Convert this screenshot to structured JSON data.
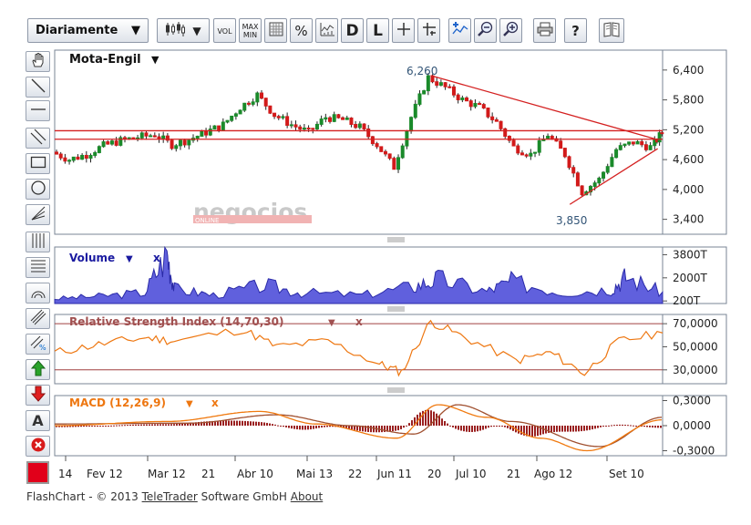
{
  "toolbar": {
    "period": "Diariamente",
    "vol_label": "VOL",
    "maxmin_label_1": "MAX",
    "maxmin_label_2": "MIN",
    "percent_label": "%",
    "d_label": "D",
    "l_label": "L",
    "help_label": "?"
  },
  "footer": {
    "prefix": "FlashChart - © 2013",
    "company_link": "TeleTrader",
    "middle": "Software GmbH",
    "about_link": "About"
  },
  "watermark": {
    "big": "negocios",
    "small": "ONLINE"
  },
  "chart_data": [
    {
      "panel": "price",
      "type": "candlestick",
      "title": "Mota-Engil",
      "y_ticks": [
        "6,400",
        "5,800",
        "5,200",
        "4,600",
        "4,000",
        "3,400"
      ],
      "ylim": [
        3100,
        6800
      ],
      "annotations": [
        {
          "text": "6,260",
          "value": 6260,
          "note": "high"
        },
        {
          "text": "3,850",
          "value": 3850,
          "note": "low"
        }
      ],
      "horizontal_lines": [
        5180,
        5010
      ],
      "trendlines": [
        {
          "from": {
            "date": "Jun 17",
            "value": 6290
          },
          "to": {
            "date": "Set 18",
            "value": 5000
          }
        },
        {
          "from": {
            "date": "Ago 13",
            "value": 3700
          },
          "to": {
            "date": "Set 18",
            "value": 4820
          }
        }
      ],
      "close_series": [
        {
          "d": "Jan 14",
          "v": 4750
        },
        {
          "d": "Jan 21",
          "v": 4600
        },
        {
          "d": "Jan 28",
          "v": 4700
        },
        {
          "d": "Fev 4",
          "v": 4880
        },
        {
          "d": "Fev 11",
          "v": 4980
        },
        {
          "d": "Fev 18",
          "v": 5050
        },
        {
          "d": "Fev 25",
          "v": 5100
        },
        {
          "d": "Mar 4",
          "v": 4900
        },
        {
          "d": "Mar 11",
          "v": 5000
        },
        {
          "d": "Mar 18",
          "v": 5150
        },
        {
          "d": "Mar 25",
          "v": 5300
        },
        {
          "d": "Abr 1",
          "v": 5650
        },
        {
          "d": "Abr 8",
          "v": 5900
        },
        {
          "d": "Abr 15",
          "v": 5500
        },
        {
          "d": "Abr 22",
          "v": 5300
        },
        {
          "d": "Abr 29",
          "v": 5150
        },
        {
          "d": "Mai 6",
          "v": 5450
        },
        {
          "d": "Mai 13",
          "v": 5400
        },
        {
          "d": "Mai 20",
          "v": 5250
        },
        {
          "d": "Mai 27",
          "v": 4900
        },
        {
          "d": "Jun 3",
          "v": 4450
        },
        {
          "d": "Jun 10",
          "v": 5450
        },
        {
          "d": "Jun 17",
          "v": 6250
        },
        {
          "d": "Jun 24",
          "v": 6050
        },
        {
          "d": "Jul 1",
          "v": 5800
        },
        {
          "d": "Jul 8",
          "v": 5650
        },
        {
          "d": "Jul 15",
          "v": 5350
        },
        {
          "d": "Jul 22",
          "v": 4850
        },
        {
          "d": "Jul 29",
          "v": 4700
        },
        {
          "d": "Ago 5",
          "v": 5100
        },
        {
          "d": "Ago 12",
          "v": 4700
        },
        {
          "d": "Ago 19",
          "v": 3950
        },
        {
          "d": "Ago 26",
          "v": 4200
        },
        {
          "d": "Set 2",
          "v": 4800
        },
        {
          "d": "Set 9",
          "v": 4950
        },
        {
          "d": "Set 16",
          "v": 4850
        },
        {
          "d": "Set 20",
          "v": 5150
        }
      ]
    },
    {
      "panel": "volume",
      "type": "area",
      "title": "Volume",
      "y_ticks": [
        "3800T",
        "2000T",
        "200T"
      ],
      "ylim": [
        0,
        4400
      ],
      "series": [
        {
          "d": "Jan 14",
          "v": 400
        },
        {
          "d": "Feb 1",
          "v": 600
        },
        {
          "d": "Feb 20",
          "v": 900
        },
        {
          "d": "Mar 1",
          "v": 4100
        },
        {
          "d": "Mar 4",
          "v": 1200
        },
        {
          "d": "Mar 20",
          "v": 700
        },
        {
          "d": "Abr 10",
          "v": 1500
        },
        {
          "d": "Abr 25",
          "v": 900
        },
        {
          "d": "Mai 20",
          "v": 700
        },
        {
          "d": "Jun 10",
          "v": 1400
        },
        {
          "d": "Jun 20",
          "v": 2000
        },
        {
          "d": "Jul 10",
          "v": 1000
        },
        {
          "d": "Jul 20",
          "v": 1800
        },
        {
          "d": "Ago 10",
          "v": 900
        },
        {
          "d": "Ago 30",
          "v": 1200
        },
        {
          "d": "Set 5",
          "v": 2200
        },
        {
          "d": "Set 20",
          "v": 900
        }
      ]
    },
    {
      "panel": "rsi",
      "type": "line",
      "title": "Relative Strength Index (14,70,30)",
      "y_ticks": [
        "70,0000",
        "50,0000",
        "30,0000"
      ],
      "ylim": [
        18,
        78
      ],
      "horizontal_lines": [
        70,
        30
      ],
      "series": [
        {
          "d": "Jan 14",
          "v": 45
        },
        {
          "d": "Feb 1",
          "v": 52
        },
        {
          "d": "Feb 20",
          "v": 58
        },
        {
          "d": "Mar 4",
          "v": 55
        },
        {
          "d": "Abr 1",
          "v": 65
        },
        {
          "d": "Abr 15",
          "v": 50
        },
        {
          "d": "Mai 6",
          "v": 55
        },
        {
          "d": "Mai 27",
          "v": 35
        },
        {
          "d": "Jun 5",
          "v": 28
        },
        {
          "d": "Jun 17",
          "v": 72
        },
        {
          "d": "Jul 1",
          "v": 58
        },
        {
          "d": "Jul 22",
          "v": 38
        },
        {
          "d": "Ago 5",
          "v": 45
        },
        {
          "d": "Ago 19",
          "v": 27
        },
        {
          "d": "Set 2",
          "v": 55
        },
        {
          "d": "Set 20",
          "v": 62
        }
      ]
    },
    {
      "panel": "macd",
      "type": "line+histogram",
      "title": "MACD (12,26,9)",
      "y_ticks": [
        "0,3000",
        "0,0000",
        "-0,3000"
      ],
      "ylim": [
        -0.36,
        0.36
      ],
      "macd": [
        {
          "d": "Jan 14",
          "v": 0.0
        },
        {
          "d": "Mar 1",
          "v": 0.05
        },
        {
          "d": "Abr 8",
          "v": 0.17
        },
        {
          "d": "Mai 1",
          "v": 0.02
        },
        {
          "d": "Jun 3",
          "v": -0.15
        },
        {
          "d": "Jun 20",
          "v": 0.25
        },
        {
          "d": "Jul 10",
          "v": 0.1
        },
        {
          "d": "Ago 1",
          "v": -0.15
        },
        {
          "d": "Ago 20",
          "v": -0.3
        },
        {
          "d": "Set 20",
          "v": 0.07
        }
      ],
      "signal": [
        {
          "d": "Jan 14",
          "v": 0.02
        },
        {
          "d": "Mar 10",
          "v": 0.03
        },
        {
          "d": "Abr 15",
          "v": 0.13
        },
        {
          "d": "Mai 15",
          "v": 0.0
        },
        {
          "d": "Jun 10",
          "v": -0.1
        },
        {
          "d": "Jun 28",
          "v": 0.25
        },
        {
          "d": "Jul 20",
          "v": 0.05
        },
        {
          "d": "Ago 25",
          "v": -0.25
        },
        {
          "d": "Set 20",
          "v": 0.1
        }
      ]
    },
    {
      "panel": "x-axis",
      "type": "axis",
      "x_tick_labels": [
        "14",
        "Fev 12",
        "Mar 12",
        "21",
        "Abr 10",
        "Mai 13",
        "22",
        "Jun 11",
        "20",
        "Jul 10",
        "21",
        "Ago 12",
        "Set 10"
      ]
    }
  ]
}
